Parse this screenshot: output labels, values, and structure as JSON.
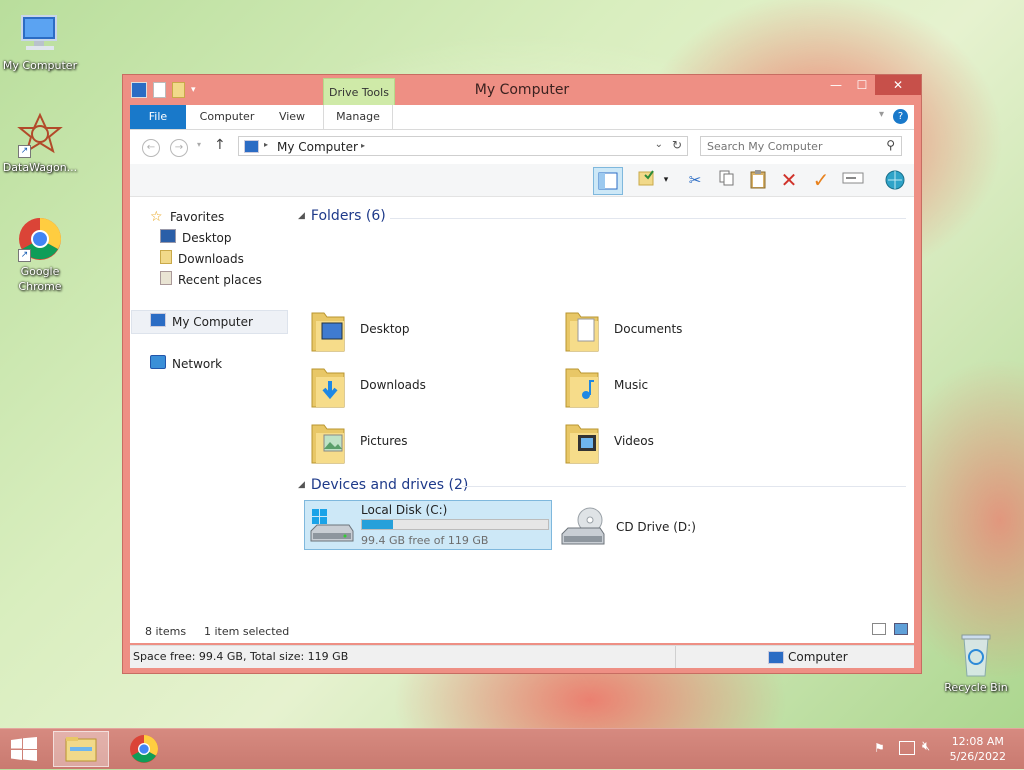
{
  "desktop": {
    "icons": [
      {
        "label": "My Computer"
      },
      {
        "label": "DataWagon..."
      },
      {
        "label": "Google Chrome"
      },
      {
        "label": "Recycle Bin"
      }
    ]
  },
  "window": {
    "title": "My Computer",
    "context_tab": "Drive Tools",
    "tabs": [
      "File",
      "Computer",
      "View",
      "Manage"
    ],
    "address": "My Computer",
    "search_placeholder": "Search My Computer"
  },
  "nav": {
    "favorites": "Favorites",
    "items": [
      "Desktop",
      "Downloads",
      "Recent places"
    ],
    "computer": "My Computer",
    "network": "Network"
  },
  "content": {
    "folders_header": "Folders (6)",
    "folders": [
      "Desktop",
      "Documents",
      "Downloads",
      "Music",
      "Pictures",
      "Videos"
    ],
    "devices_header": "Devices and drives (2)",
    "drives": [
      {
        "name": "Local Disk (C:)",
        "free_text": "99.4 GB free of 119 GB",
        "used_fraction": 0.165
      },
      {
        "name": "CD Drive (D:)"
      }
    ]
  },
  "status": {
    "items": "8 items",
    "selected": "1 item selected",
    "space": "Space free: 99.4 GB, Total size: 119 GB",
    "location": "Computer"
  },
  "taskbar": {
    "time": "12:08 AM",
    "date": "5/26/2022"
  },
  "colors": {
    "accent": "#1979ca",
    "window_frame": "#ee8f84",
    "close": "#c7504a",
    "drive_tools": "#cfeaa8",
    "selection": "#cde8f7",
    "bar_fill": "#26a0da"
  }
}
